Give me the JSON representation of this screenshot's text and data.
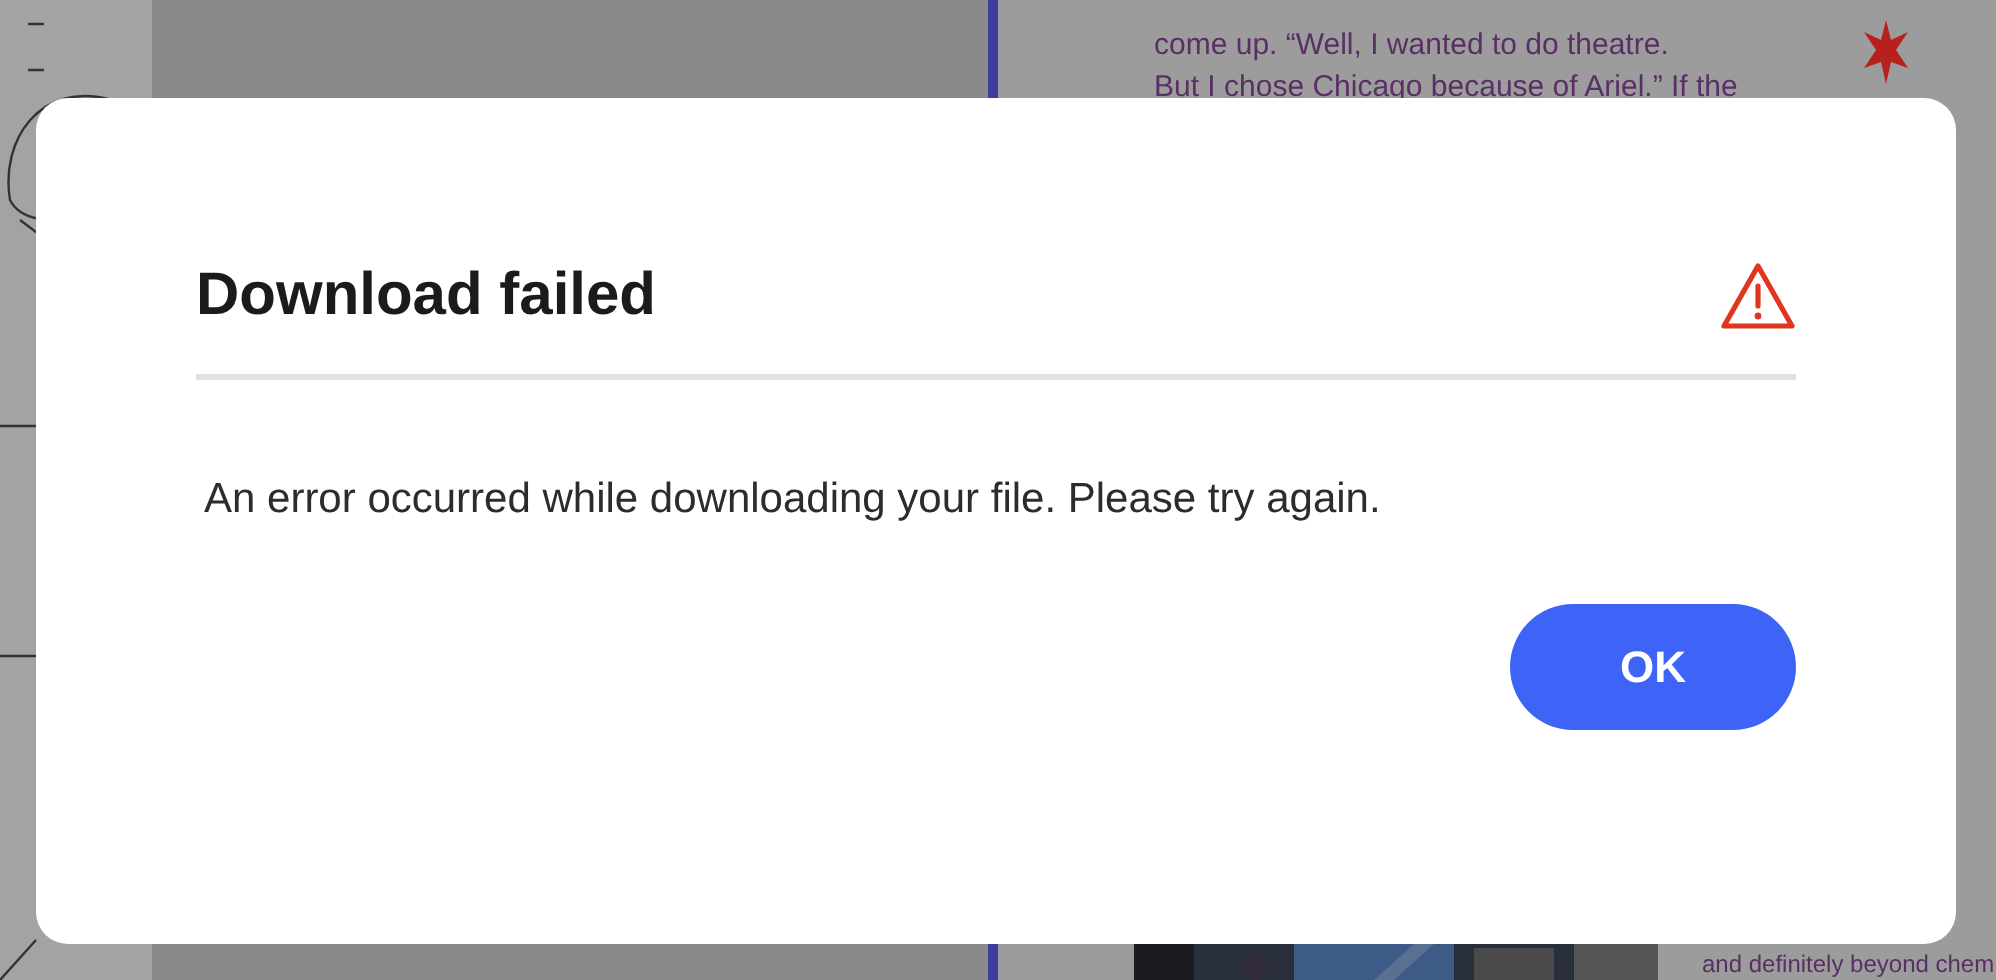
{
  "document": {
    "main_lines": [
      "come up. “Well, I wanted to do theatre.",
      "But I chose Chicago because of Ariel.” If the"
    ],
    "bottom_line": "and definitely beyond chem"
  },
  "dialog": {
    "title": "Download failed",
    "message": "An error occurred while downloading your file. Please try again.",
    "buttons": [
      "OK"
    ]
  }
}
